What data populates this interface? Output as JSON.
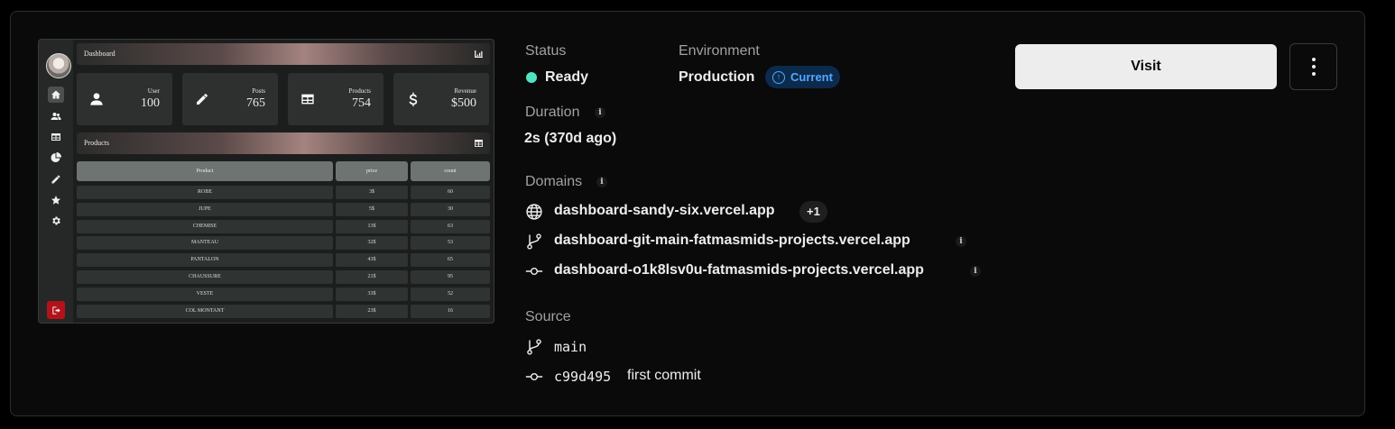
{
  "preview": {
    "header_title": "Dashboard",
    "stats": [
      {
        "label": "User",
        "value": "100"
      },
      {
        "label": "Posts",
        "value": "765"
      },
      {
        "label": "Products",
        "value": "754"
      },
      {
        "label": "Revenue",
        "value": "$500"
      }
    ],
    "products_title": "Products",
    "table_headers": [
      "Product",
      "price",
      "count"
    ],
    "table_rows": [
      [
        "ROBE",
        "3$",
        "60"
      ],
      [
        "JUPE",
        "5$",
        "30"
      ],
      [
        "CHEMISE",
        "13$",
        "63"
      ],
      [
        "MANTEAU",
        "32$",
        "53"
      ],
      [
        "PANTALON",
        "43$",
        "65"
      ],
      [
        "CHAUSSURE",
        "21$",
        "95"
      ],
      [
        "VESTE",
        "33$",
        "52"
      ],
      [
        "COL MONTANT",
        "23$",
        "16"
      ]
    ]
  },
  "status": {
    "label": "Status",
    "value": "Ready",
    "color": "#50e3c2"
  },
  "environment": {
    "label": "Environment",
    "value": "Production",
    "badge": "Current"
  },
  "duration": {
    "label": "Duration",
    "value": "2s (370d ago)"
  },
  "domains": {
    "label": "Domains",
    "items": [
      {
        "icon": "globe-icon",
        "text": "dashboard-sandy-six.vercel.app",
        "extra": "+1"
      },
      {
        "icon": "git-branch-icon",
        "text": "dashboard-git-main-fatmasmids-projects.vercel.app"
      },
      {
        "icon": "git-commit-icon",
        "text": "dashboard-o1k8lsv0u-fatmasmids-projects.vercel.app"
      }
    ]
  },
  "source": {
    "label": "Source",
    "branch": "main",
    "commit_hash": "c99d495",
    "commit_message": "first commit"
  },
  "actions": {
    "visit_label": "Visit"
  }
}
